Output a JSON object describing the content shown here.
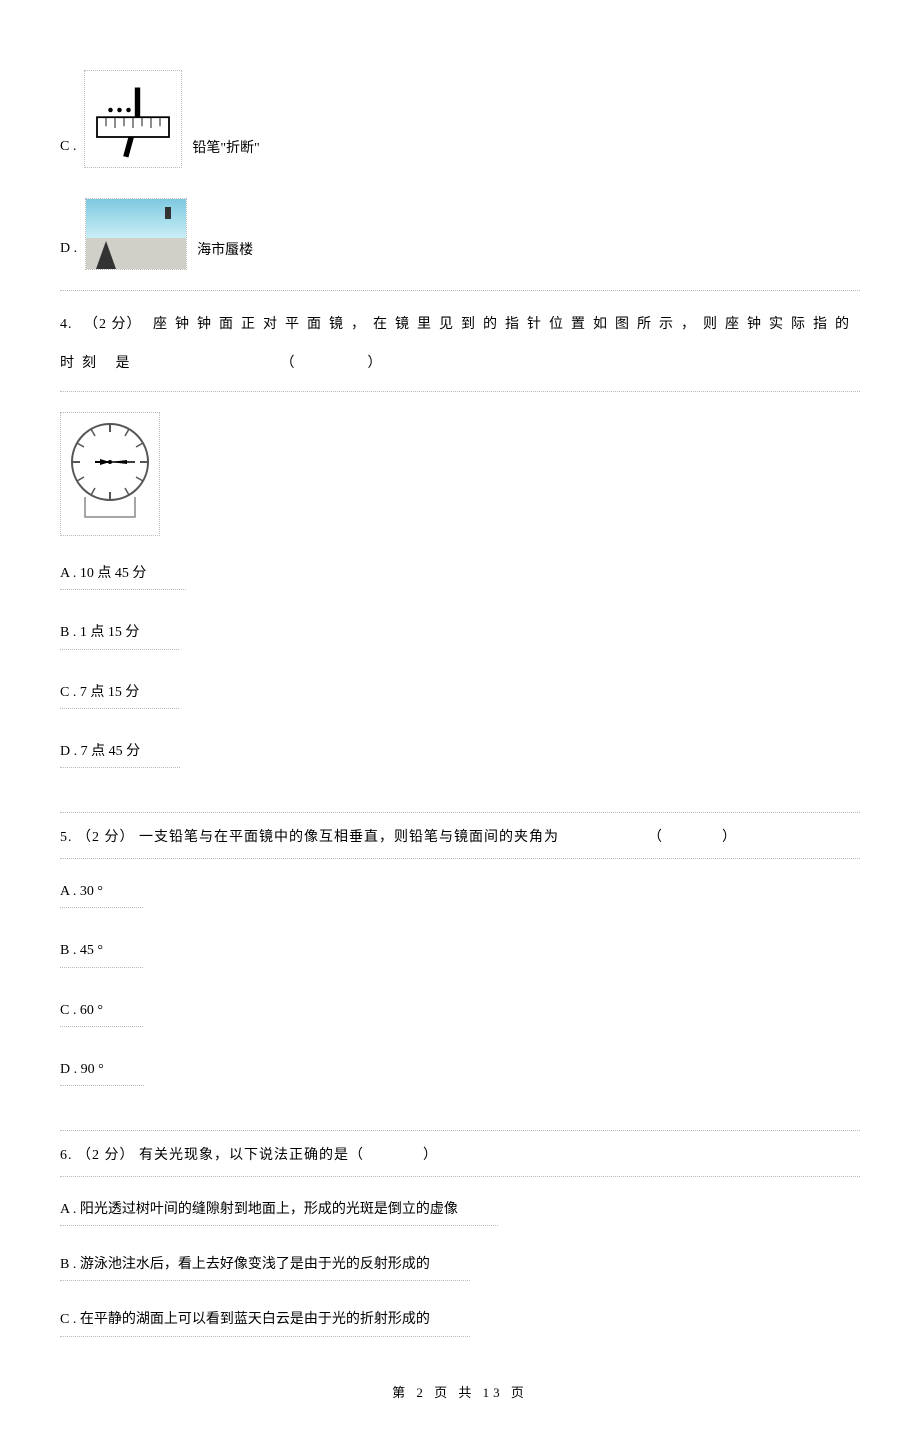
{
  "prev_options": {
    "c": {
      "label": "C .",
      "caption": "铅笔\"折断\""
    },
    "d": {
      "label": "D .",
      "caption": "海市蜃楼"
    }
  },
  "q4": {
    "number": "4.",
    "points": "（2 分）",
    "text_part1": "座钟钟面正对平面镜，在镜里见到的指针位置如图所示，则座钟实际指的时刻",
    "text_part2": "是",
    "paren_open": "（",
    "paren_close": "）",
    "options": {
      "a": "A . 10  点 45 分",
      "b": "B . 1  点 15 分",
      "c": "C . 7  点 15 分",
      "d": "D . 7  点 45 分"
    }
  },
  "q5": {
    "number": "5.",
    "points": " （2 分）",
    "text": "一支铅笔与在平面镜中的像互相垂直，则铅笔与镜面间的夹角为",
    "paren_open": "（",
    "paren_close": "）",
    "options": {
      "a": "A . 30 °",
      "b": "B . 45 °",
      "c": "C . 60 °",
      "d": "D . 90 °"
    }
  },
  "q6": {
    "number": "6.",
    "points": " （2 分）",
    "text": "有关光现象，以下说法正确的是（",
    "paren_close": "）",
    "options": {
      "a": "A .  阳光透过树叶间的缝隙射到地面上，形成的光斑是倒立的虚像",
      "b": "B .  游泳池注水后，看上去好像变浅了是由于光的反射形成的",
      "c": "C .  在平静的湖面上可以看到蓝天白云是由于光的折射形成的"
    }
  },
  "footer": "第 2 页 共 13 页"
}
